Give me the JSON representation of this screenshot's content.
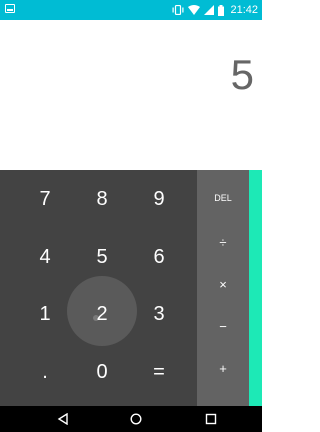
{
  "status_bar": {
    "time": "21:42",
    "icons": [
      "notification-icon",
      "vibrate-icon",
      "wifi-icon",
      "signal-icon",
      "battery-icon"
    ],
    "background": "#00bcd4"
  },
  "display": {
    "result": "5"
  },
  "keypad": {
    "keys": [
      "7",
      "8",
      "9",
      "4",
      "5",
      "6",
      "1",
      "2",
      "3",
      ".",
      "0",
      "="
    ]
  },
  "operators": {
    "items": [
      "DEL",
      "÷",
      "×",
      "−",
      "+"
    ]
  },
  "nav_bar": {
    "icons": [
      "back-icon",
      "home-icon",
      "recents-icon"
    ]
  },
  "colors": {
    "keypad_bg": "#434343",
    "operator_bg": "#636363",
    "accent": "#1de9b6"
  }
}
